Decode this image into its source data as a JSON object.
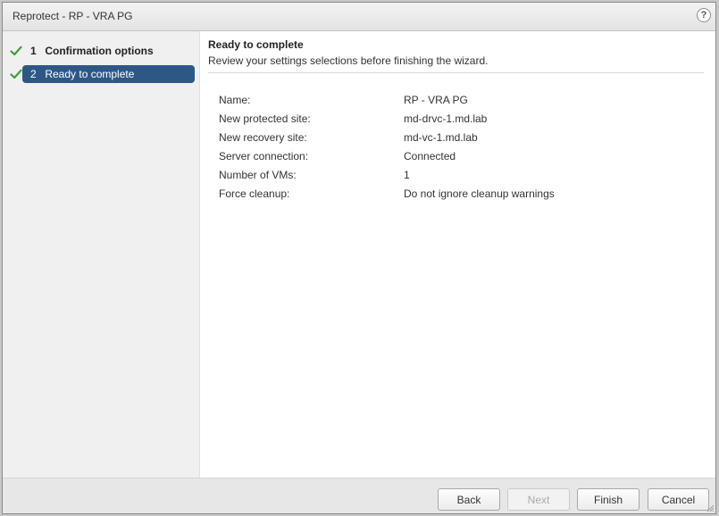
{
  "window": {
    "title": "Reprotect - RP - VRA PG",
    "help_glyph": "?"
  },
  "steps": [
    {
      "number": "1",
      "label": "Confirmation options",
      "completed": true,
      "active": false
    },
    {
      "number": "2",
      "label": "Ready to complete",
      "completed": true,
      "active": true
    }
  ],
  "content": {
    "title": "Ready to complete",
    "subtitle": "Review your settings selections before finishing the wizard.",
    "summary": [
      {
        "key": "Name:",
        "value": "RP - VRA PG"
      },
      {
        "key": "New protected site:",
        "value": "md-drvc-1.md.lab"
      },
      {
        "key": "New recovery site:",
        "value": "md-vc-1.md.lab"
      },
      {
        "key": "Server connection:",
        "value": "Connected"
      },
      {
        "key": "Number of VMs:",
        "value": "1"
      },
      {
        "key": "Force cleanup:",
        "value": "Do not ignore cleanup warnings"
      }
    ]
  },
  "footer": {
    "back_label": "Back",
    "next_label": "Next",
    "finish_label": "Finish",
    "cancel_label": "Cancel"
  },
  "colors": {
    "active_step": "#2d5886",
    "check": "#3aa02f"
  }
}
